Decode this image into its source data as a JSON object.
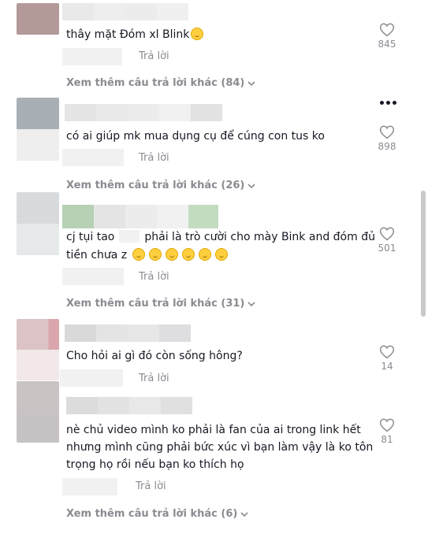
{
  "labels": {
    "reply": "Trả lời",
    "more_options_icon": "more-horizontal-icon",
    "heart_icon": "heart-outline-icon",
    "chevron_icon": "chevron-down-icon"
  },
  "comments": [
    {
      "text": "thây mặt Đóm xl Blink",
      "emoji_count": 1,
      "likes": "845",
      "more_replies": "Xem thêm câu trả lời khác (84)"
    },
    {
      "text": "có ai giúp mk mua dụng cụ để cúng con tus ko",
      "likes": "898",
      "more_replies": "Xem thêm câu trả lời khác (26)"
    },
    {
      "text_line1_prefix": "cj tụi tao",
      "text_line1_suffix": "phải là trò cười cho mày Bink and đóm đủ",
      "text_line2": "tiền chưa z",
      "emoji_count": 6,
      "likes": "501",
      "more_replies": "Xem thêm câu trả lời khác (31)"
    },
    {
      "text": "Cho hỏi ai gì đó còn sống hông?",
      "likes": "14"
    },
    {
      "text_line1": "nè chủ video mình ko phải là fan của ai trong link hết",
      "text_line2": "nhưng mình cũng phải bức xúc vì bạn làm vậy là ko tôn",
      "text_line3": "trọng họ rồi nếu bạn ko thích họ",
      "likes": "81",
      "more_replies": "Xem thêm câu trả lời khác (6)"
    }
  ],
  "colors": {
    "text": "#161823",
    "muted": "#8a8b91",
    "blur": "#f1f1f2",
    "emoji": "#ffcf3f"
  }
}
